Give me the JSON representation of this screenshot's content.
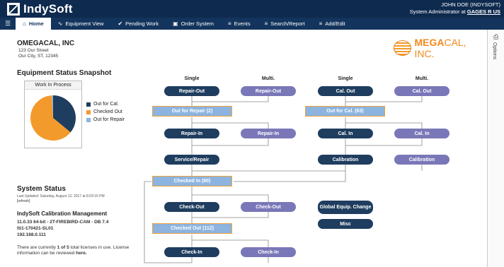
{
  "header": {
    "app_name": "IndySoft",
    "user_name": "JOHN DOE (INDYSOFT)",
    "user_role": "System Administrator at",
    "org_link": "GAGES R US"
  },
  "nav": {
    "items": [
      {
        "label": "Home",
        "icon": "home-icon"
      },
      {
        "label": "Equipment View",
        "icon": "pulse-icon"
      },
      {
        "label": "Pending Work",
        "icon": "check-icon"
      },
      {
        "label": "Order System",
        "icon": "bag-icon"
      },
      {
        "label": "Events",
        "icon": "list-icon"
      },
      {
        "label": "Search/Report",
        "icon": "list-icon"
      },
      {
        "label": "Add/Edit",
        "icon": "list-icon"
      }
    ],
    "active": "Home"
  },
  "company": {
    "name": "OMEGACAL, INC",
    "street": "123 Our Street",
    "city": "Our City, ST, 12345",
    "logo_text_a": "MEGA",
    "logo_text_b": "CAL, INC."
  },
  "options_label": "Options",
  "snapshot": {
    "title": "Equipment Status Snapshot",
    "chart_title": "Work In Process",
    "legend": [
      {
        "label": "Out for Cal.",
        "color": "#1f3d5f"
      },
      {
        "label": "Checked Out",
        "color": "#f39a2c"
      },
      {
        "label": "Out for Repair",
        "color": "#8cb4df"
      }
    ]
  },
  "chart_data": {
    "type": "pie",
    "title": "Work In Process",
    "categories": [
      "Out for Cal.",
      "Checked Out",
      "Out for Repair"
    ],
    "values": [
      36,
      63,
      1
    ]
  },
  "status": {
    "title": "System Status",
    "updated": "Last Updated: Saturday, August 12, 2017 at 8:03:15 PM",
    "refresh": "[refresh]",
    "mgmt_title": "IndySoft Calibration Management",
    "line1": "11.0.33 64-bit - 2T-FIREBIRD-CAM - DB 7.4",
    "line2": "IS1-170421-SL01",
    "line3": "192.168.0.111",
    "license_a": "There are currently",
    "license_b": "1 of 5",
    "license_c": "total licenses in use.",
    "license_d": "License information can be reviewed",
    "license_link": "here."
  },
  "workflow": {
    "heads": [
      "Single",
      "Multi.",
      "Single",
      "Multi."
    ],
    "repair_out": "Repair-Out",
    "repair_out_multi": "Repair-Out",
    "cal_out": "Cal. Out",
    "cal_out_multi": "Cal. Out",
    "out_for_repair": "Out for Repair (2)",
    "out_for_cal": "Out for Cal. (63)",
    "repair_in": "Repair-In",
    "repair_in_multi": "Repair-In",
    "cal_in": "Cal. In",
    "cal_in_multi": "Cal. In",
    "service_repair": "Service/Repair",
    "calibration": "Calibration",
    "calibration_multi": "Calibration",
    "checked_in": "Checked In (80)",
    "check_out": "Check-Out",
    "check_out_multi": "Check-Out",
    "global_change": "Global Equip. Change",
    "misc": "Misc",
    "checked_out": "Checked Out (112)",
    "check_in": "Check-In",
    "check_in_multi": "Check-In"
  }
}
